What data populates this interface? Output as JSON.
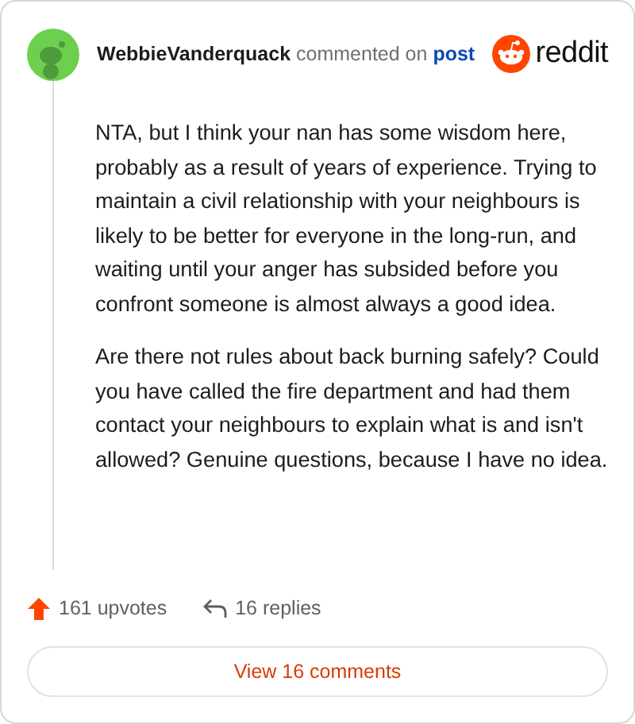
{
  "comment": {
    "author": "WebbieVanderquack",
    "action": "commented on",
    "link": "post",
    "brand": "reddit",
    "paragraphs": [
      "NTA, but I think your nan has some wisdom here, probably as a result of years of experience. Trying to maintain a civil relationship with your neighbours is likely to be better for everyone in the long-run, and waiting until your anger has subsided before you confront someone is almost always a good idea.",
      "Are there not rules about back burning safely? Could you have called the fire department and had them contact your neighbours to explain what is and isn't allowed? Genuine questions, because I have no idea."
    ],
    "upvotes": "161 upvotes",
    "replies": "16 replies",
    "button": "View 16 comments"
  }
}
